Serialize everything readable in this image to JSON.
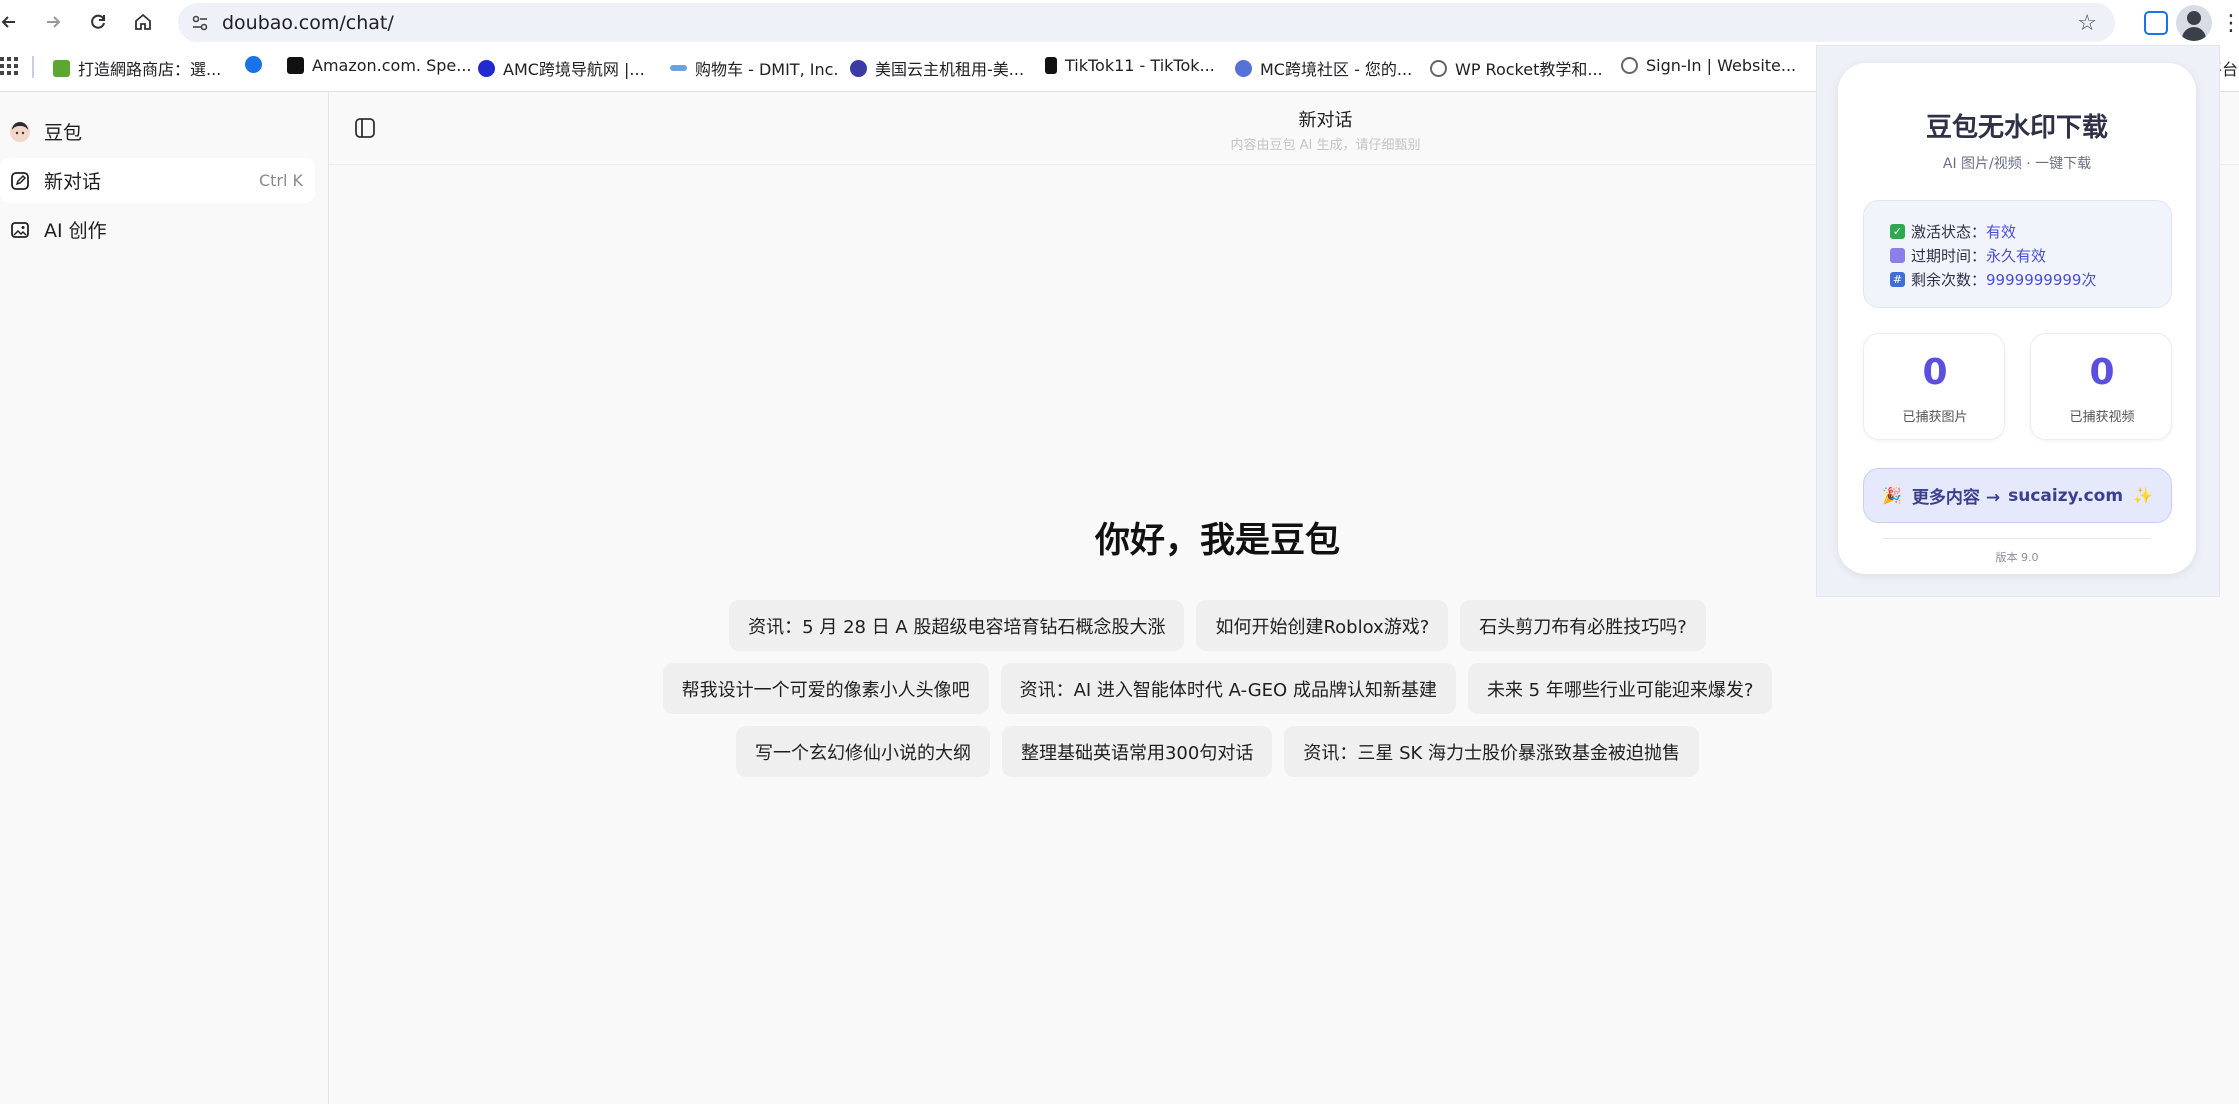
{
  "browser": {
    "url": "doubao.com/chat/",
    "bookmarks": [
      {
        "label": "打造網路商店：選...",
        "color": "#5aa832"
      },
      {
        "label": "",
        "color": "#1a73e8"
      },
      {
        "label": "Amazon.com. Spe...",
        "color": "#111111"
      },
      {
        "label": "AMC跨境导航网 |...",
        "color": "#1f2bd1"
      },
      {
        "label": "购物车 - DMIT, Inc.",
        "color": "#6aa3e0"
      },
      {
        "label": "美国云主机租用-美...",
        "color": "#3b3ba8"
      },
      {
        "label": "TikTok11 - TikTok...",
        "color": "#111111"
      },
      {
        "label": "MC跨境社区 - 您的...",
        "color": "#5672d6"
      },
      {
        "label": "WP Rocket教学和...",
        "color": "#666666"
      },
      {
        "label": "Sign-In | Website...",
        "color": "#666666"
      },
      {
        "label": "平台",
        "color": "#666666"
      }
    ]
  },
  "sidebar": {
    "brand": "豆包",
    "new_chat": "新对话",
    "new_chat_shortcut": "Ctrl K",
    "ai_create": "AI 创作"
  },
  "header": {
    "title": "新对话",
    "subtitle": "内容由豆包 AI 生成，请仔细甄别"
  },
  "main": {
    "greeting": "你好，我是豆包",
    "suggestion_rows": [
      [
        "资讯：5 月 28 日 A 股超级电容培育钻石概念股大涨",
        "如何开始创建Roblox游戏?",
        "石头剪刀布有必胜技巧吗?"
      ],
      [
        "帮我设计一个可爱的像素小人头像吧",
        "资讯：AI 进入智能体时代 A-GEO 成品牌认知新基建",
        "未来 5 年哪些行业可能迎来爆发?"
      ],
      [
        "写一个玄幻修仙小说的大纲",
        "整理基础英语常用300句对话",
        "资讯：三星 SK 海力士股价暴涨致基金被迫抛售"
      ]
    ]
  },
  "extension_popup": {
    "title": "豆包无水印下载",
    "subtitle": "AI 图片/视频 · 一键下载",
    "status": [
      {
        "label": "激活状态：",
        "value": "有效",
        "icon": "check-icon",
        "color": "#2fa84f"
      },
      {
        "label": "过期时间：",
        "value": "永久有效",
        "icon": "calendar-icon",
        "color": "#8b7fe8"
      },
      {
        "label": "剩余次数：",
        "value": "9999999999次",
        "icon": "numbers-icon",
        "color": "#3f6fd6"
      }
    ],
    "captured_images_count": "0",
    "captured_images_label": "已捕获图片",
    "captured_videos_count": "0",
    "captured_videos_label": "已捕获视频",
    "more_prefix": "更多内容 →",
    "more_link": "sucaizy.com",
    "version": "版本 9.0",
    "accent": "#5b4fe0"
  }
}
